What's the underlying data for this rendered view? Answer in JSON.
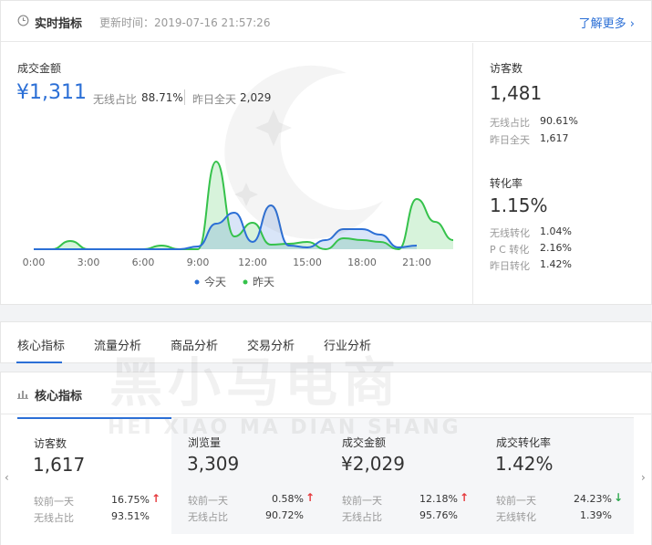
{
  "realtime": {
    "title": "实时指标",
    "update_time": "更新时间：2019-07-16 21:57:26",
    "more_link": "了解更多 ›",
    "gmv": {
      "label": "成交金额",
      "value": "¥1,311",
      "wireless_label": "无线占比",
      "wireless_value": "88.71%",
      "yesterday_label": "昨日全天",
      "yesterday_value": "2,029"
    },
    "visitors": {
      "label": "访客数",
      "value": "1,481",
      "rows": [
        {
          "label": "无线占比",
          "value": "90.61%"
        },
        {
          "label": "昨日全天",
          "value": "1,617"
        }
      ]
    },
    "conversion": {
      "label": "转化率",
      "value": "1.15%",
      "rows": [
        {
          "label": "无线转化",
          "value": "1.04%"
        },
        {
          "label": "P C 转化",
          "value": "2.16%"
        },
        {
          "label": "昨日转化",
          "value": "1.42%"
        }
      ]
    }
  },
  "chart_data": {
    "type": "area",
    "x": [
      0,
      1,
      2,
      3,
      4,
      5,
      6,
      7,
      8,
      9,
      10,
      11,
      12,
      13,
      14,
      15,
      16,
      17,
      18,
      19,
      20,
      21,
      22,
      23
    ],
    "x_tick_labels": [
      "0:00",
      "3:00",
      "6:00",
      "9:00",
      "12:00",
      "15:00",
      "18:00",
      "21:00"
    ],
    "series": [
      {
        "name": "今天",
        "color": "#2b6fd6",
        "fill": "rgba(43,111,214,0.18)",
        "values": [
          0,
          0,
          0,
          0,
          0,
          0,
          0,
          0,
          0,
          3,
          28,
          40,
          8,
          48,
          4,
          2,
          10,
          22,
          22,
          16,
          2,
          4
        ]
      },
      {
        "name": "昨天",
        "color": "#35c24b",
        "fill": "rgba(53,194,75,0.20)",
        "values": [
          0,
          0,
          9,
          0,
          0,
          0,
          0,
          4,
          0,
          0,
          96,
          14,
          29,
          5,
          6,
          8,
          0,
          12,
          10,
          8,
          0,
          55,
          30,
          10
        ]
      }
    ],
    "legend_position": "bottom",
    "grid": false
  },
  "tabs": [
    "核心指标",
    "流量分析",
    "商品分析",
    "交易分析",
    "行业分析"
  ],
  "core": {
    "title": "核心指标",
    "cards": [
      {
        "label": "访客数",
        "value": "1,617",
        "row1_label": "较前一天",
        "row1_value": "16.75%",
        "trend": "up",
        "row2_label": "无线占比",
        "row2_value": "93.51%"
      },
      {
        "label": "浏览量",
        "value": "3,309",
        "row1_label": "较前一天",
        "row1_value": "0.58%",
        "trend": "up",
        "row2_label": "无线占比",
        "row2_value": "90.72%"
      },
      {
        "label": "成交金额",
        "value": "¥2,029",
        "row1_label": "较前一天",
        "row1_value": "12.18%",
        "trend": "up",
        "row2_label": "无线占比",
        "row2_value": "95.76%"
      },
      {
        "label": "成交转化率",
        "value": "1.42%",
        "row1_label": "较前一天",
        "row1_value": "24.23%",
        "trend": "down",
        "row2_label": "无线转化",
        "row2_value": "1.39%"
      }
    ]
  },
  "watermark": {
    "cn": "黑小马电商",
    "en": "HEI XIAO MA DIAN SHANG"
  },
  "colors": {
    "accent": "#2b6fd6",
    "up": "#e5383b",
    "down": "#2fa84f"
  }
}
